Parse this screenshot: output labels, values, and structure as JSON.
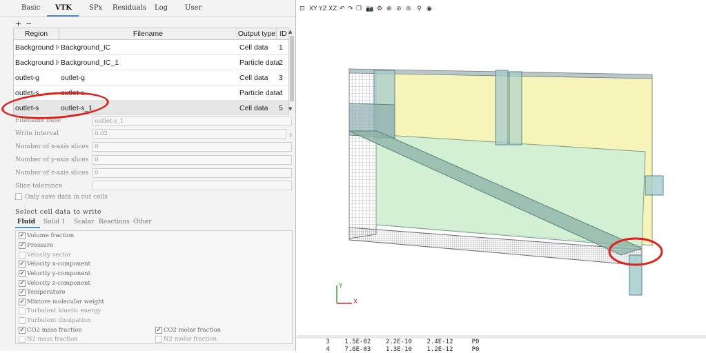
{
  "tabs": [
    "Basic",
    "VTK",
    "SPx",
    "Residuals",
    "Log",
    "User"
  ],
  "table": {
    "add": "+",
    "remove": "−",
    "headers": [
      "Region",
      "Filename",
      "Output type",
      "ID"
    ],
    "rows": [
      [
        "Background IC",
        "Background_IC",
        "Cell data",
        "1"
      ],
      [
        "Background IC",
        "Background_IC_1",
        "Particle data",
        "2"
      ],
      [
        "outlet-g",
        "outlet-g",
        "Cell data",
        "3"
      ],
      [
        "outlet-s",
        "outlet-s",
        "Particle data",
        "4"
      ],
      [
        "outlet-s",
        "outlet-s_1",
        "Cell data",
        "5"
      ]
    ],
    "scroll_up": "▲",
    "scroll_down": "▼"
  },
  "fields": [
    {
      "label": "Filename base",
      "value": "outlet-s_1"
    },
    {
      "label": "Write interval",
      "value": "0.02"
    },
    {
      "label": "Number of x-axis slices",
      "value": "0"
    },
    {
      "label": "Number of y-axis slices",
      "value": "0"
    },
    {
      "label": "Number of z-axis slices",
      "value": "0"
    },
    {
      "label": "Slice tolerance",
      "value": ""
    }
  ],
  "write_interval_unit": "s",
  "save_cut_cells": {
    "label": "Only save data in cut cells",
    "checked": false
  },
  "select_title": "Select cell data to write",
  "sub_tabs": [
    "Fluid",
    "Solid 1",
    "Scalar",
    "Reactions",
    "Other"
  ],
  "checkboxes": [
    {
      "label": "Volume fraction",
      "checked": true
    },
    {
      "label": "Pressure",
      "checked": true
    },
    {
      "label": "Velocity vector",
      "checked": false
    },
    {
      "label": "Velocity x-component",
      "checked": true
    },
    {
      "label": "Velocity y-component",
      "checked": true
    },
    {
      "label": "Velocity z-component",
      "checked": true
    },
    {
      "label": "Temperature",
      "checked": true
    },
    {
      "label": "Mixture molecular weight",
      "checked": true
    },
    {
      "label": "Turbulent kinetic energy",
      "checked": false
    },
    {
      "label": "Turbulent dissipation",
      "checked": false
    },
    {
      "label": "CO2 mass fraction",
      "checked": true
    },
    {
      "label": "N2 mass fraction",
      "checked": false
    },
    {
      "label": "CO2 molar fraction",
      "checked": true
    },
    {
      "label": "N2 molar fraction",
      "checked": false
    }
  ],
  "check_mark": "✓",
  "toolbar_icons": [
    "reset-view-icon",
    "view-xy-icon",
    "view-yz-icon",
    "view-xz-icon",
    "rotate-left-icon",
    "rotate-right-icon",
    "perspective-icon",
    "snapshot-icon",
    "settings-icon",
    "region-icon",
    "cut-icon",
    "database-icon",
    "surface-icon",
    "visibility-icon"
  ],
  "toolbar_glyphs": [
    "⊡",
    "XY",
    "YZ",
    "XZ",
    "↶",
    "↷",
    "❐",
    "📷",
    "⚙",
    "⊕",
    "⊘",
    "⊜",
    "⚲",
    "◉"
  ],
  "axes": {
    "y": "Y",
    "x": "X"
  },
  "console_lines": [
    "   3    1.5E-02    2.2E-10    2.4E-12     P0",
    "   4    7.6E-03    1.3E-10    1.2E-12     P0"
  ],
  "colors": {
    "annotation": "#e0201a",
    "tank_fill": "#f5f3b0",
    "fluid_fill": "#cceed8",
    "mesh_gray": "#8f8f98"
  }
}
